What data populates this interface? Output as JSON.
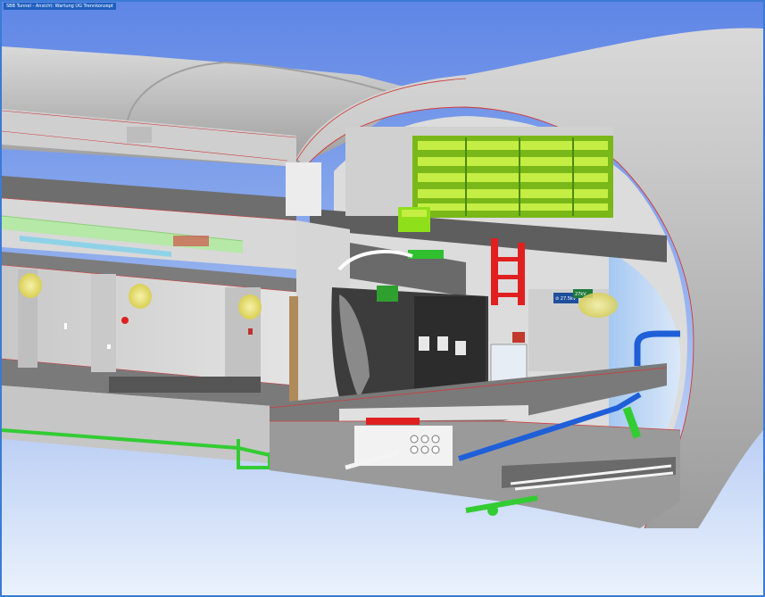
{
  "window": {
    "title": "SBB Tunnel - Ansicht: Wartung UG Trennkonzept"
  },
  "scene": {
    "signs": [
      {
        "text": "⊘ 27.5kV"
      },
      {
        "text": "27kV"
      }
    ],
    "colors": {
      "sky_top": "#5f86e6",
      "sky_bottom": "#e9f1fb",
      "tunnel_grey": "#b9b9b9",
      "outline_red": "#d23a3a",
      "cable_tray_green": "#9bd21e",
      "pipe_blue": "#1f5fd8",
      "pipe_green": "#33cc33",
      "frame_red": "#e02020",
      "lamp_yellow": "#e8e060"
    }
  }
}
